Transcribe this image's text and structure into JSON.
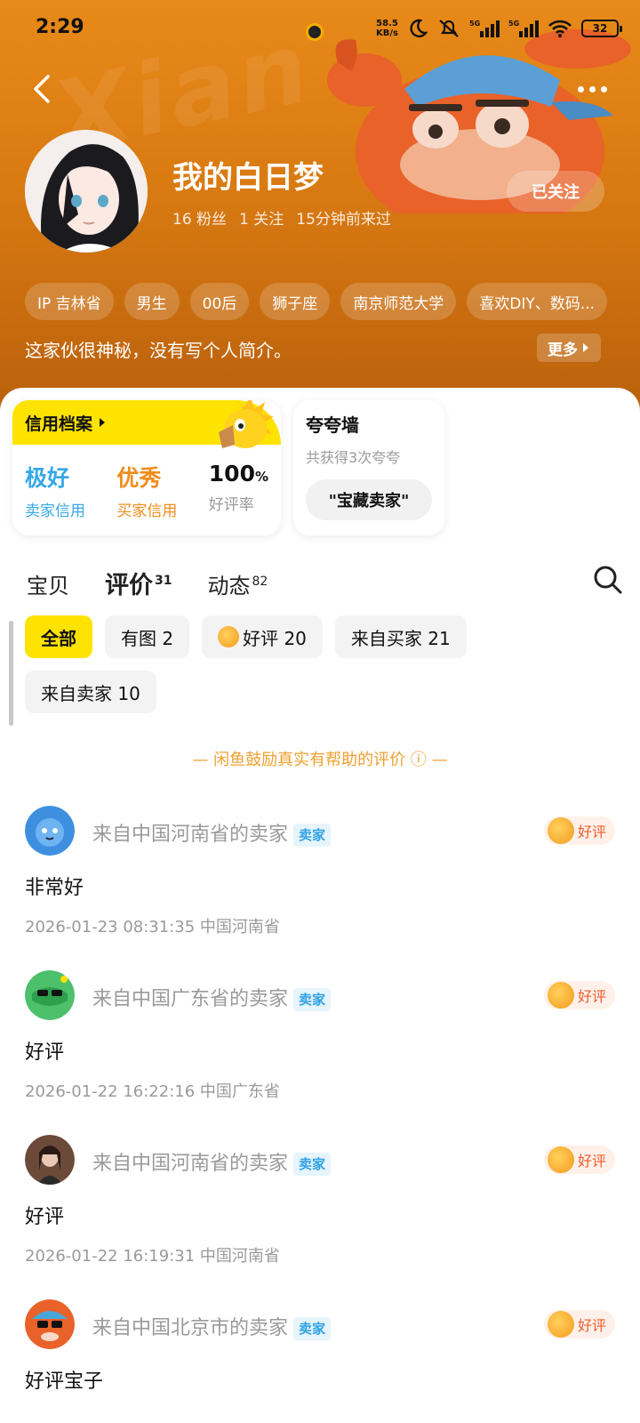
{
  "status_bar": {
    "time": "2:29",
    "speed_value": "58.5",
    "speed_unit": "KB/s",
    "battery": "32"
  },
  "profile": {
    "name": "我的白日梦",
    "fans": "16 粉丝",
    "following": "1 关注",
    "last_seen": "15分钟前来过",
    "follow_label": "已关注",
    "tags": [
      "IP 吉林省",
      "男生",
      "00后",
      "狮子座",
      "南京师范大学",
      "喜欢DIY、数码..."
    ],
    "bio": "这家伙很神秘，没有写个人简介。",
    "more_label": "更多"
  },
  "credit": {
    "title": "信用档案",
    "seller_value": "极好",
    "seller_label": "卖家信用",
    "buyer_value": "优秀",
    "buyer_label": "买家信用",
    "rate_value": "100",
    "rate_unit": "%",
    "rate_label": "好评率"
  },
  "praise": {
    "title": "夸夸墙",
    "subtitle": "共获得3次夸夸",
    "chip": "\"宝藏卖家\""
  },
  "tabs": [
    {
      "label": "宝贝",
      "count": ""
    },
    {
      "label": "评价",
      "count": "31"
    },
    {
      "label": "动态",
      "count": "82"
    }
  ],
  "filters": [
    {
      "label": "全部"
    },
    {
      "label": "有图 2"
    },
    {
      "label": "好评 20"
    },
    {
      "label": "来自买家 21"
    },
    {
      "label": "来自卖家 10"
    }
  ],
  "notice": "— 闲鱼鼓励真实有帮助的评价 ⓘ —",
  "reviews": [
    {
      "from": "来自中国河南省的卖家",
      "badge": "卖家",
      "rating": "好评",
      "text": "非常好",
      "meta": "2026-01-23 08:31:35  中国河南省"
    },
    {
      "from": "来自中国广东省的卖家",
      "badge": "卖家",
      "rating": "好评",
      "text": "好评",
      "meta": "2026-01-22 16:22:16  中国广东省"
    },
    {
      "from": "来自中国河南省的卖家",
      "badge": "卖家",
      "rating": "好评",
      "text": "好评",
      "meta": "2026-01-22 16:19:31  中国河南省"
    },
    {
      "from": "来自中国北京市的卖家",
      "badge": "卖家",
      "rating": "好评",
      "text": "好评宝子",
      "meta": ""
    }
  ]
}
